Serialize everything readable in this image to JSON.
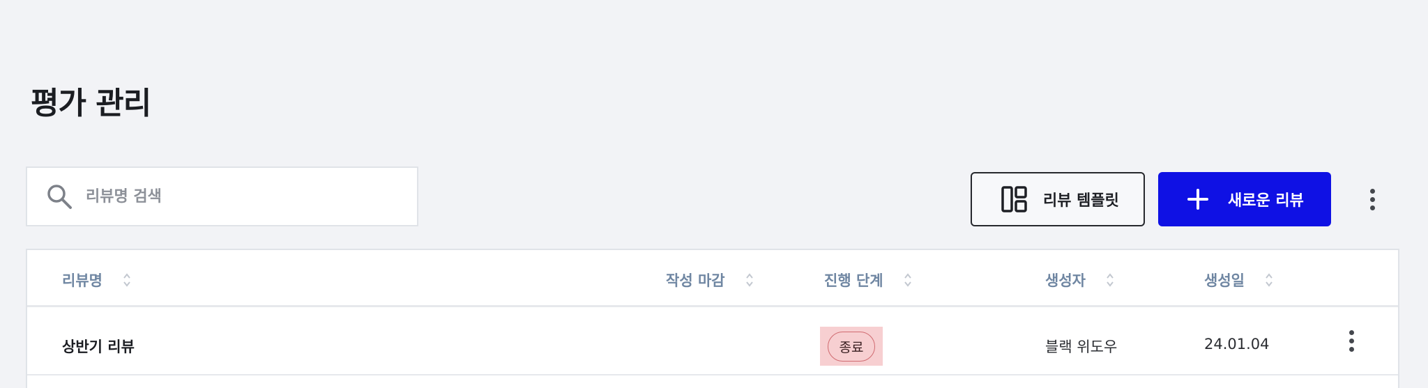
{
  "page": {
    "title": "평가 관리"
  },
  "search": {
    "placeholder": "리뷰명 검색"
  },
  "toolbar": {
    "template_label": "리뷰 템플릿",
    "new_review_label": "새로운 리뷰"
  },
  "table": {
    "columns": [
      "리뷰명",
      "작성 마감",
      "진행 단계",
      "생성자",
      "생성일"
    ],
    "rows": [
      {
        "name": "상반기 리뷰",
        "deadline": "",
        "stage": "종료",
        "creator": "블랙 위도우",
        "created": "24.01.04"
      }
    ]
  },
  "colors": {
    "primary": "#0f11e4",
    "background": "#f2f3f6",
    "header_text": "#6f86a2",
    "status_end_bg": "#f7cfd1",
    "status_end_border": "#d06a70"
  }
}
